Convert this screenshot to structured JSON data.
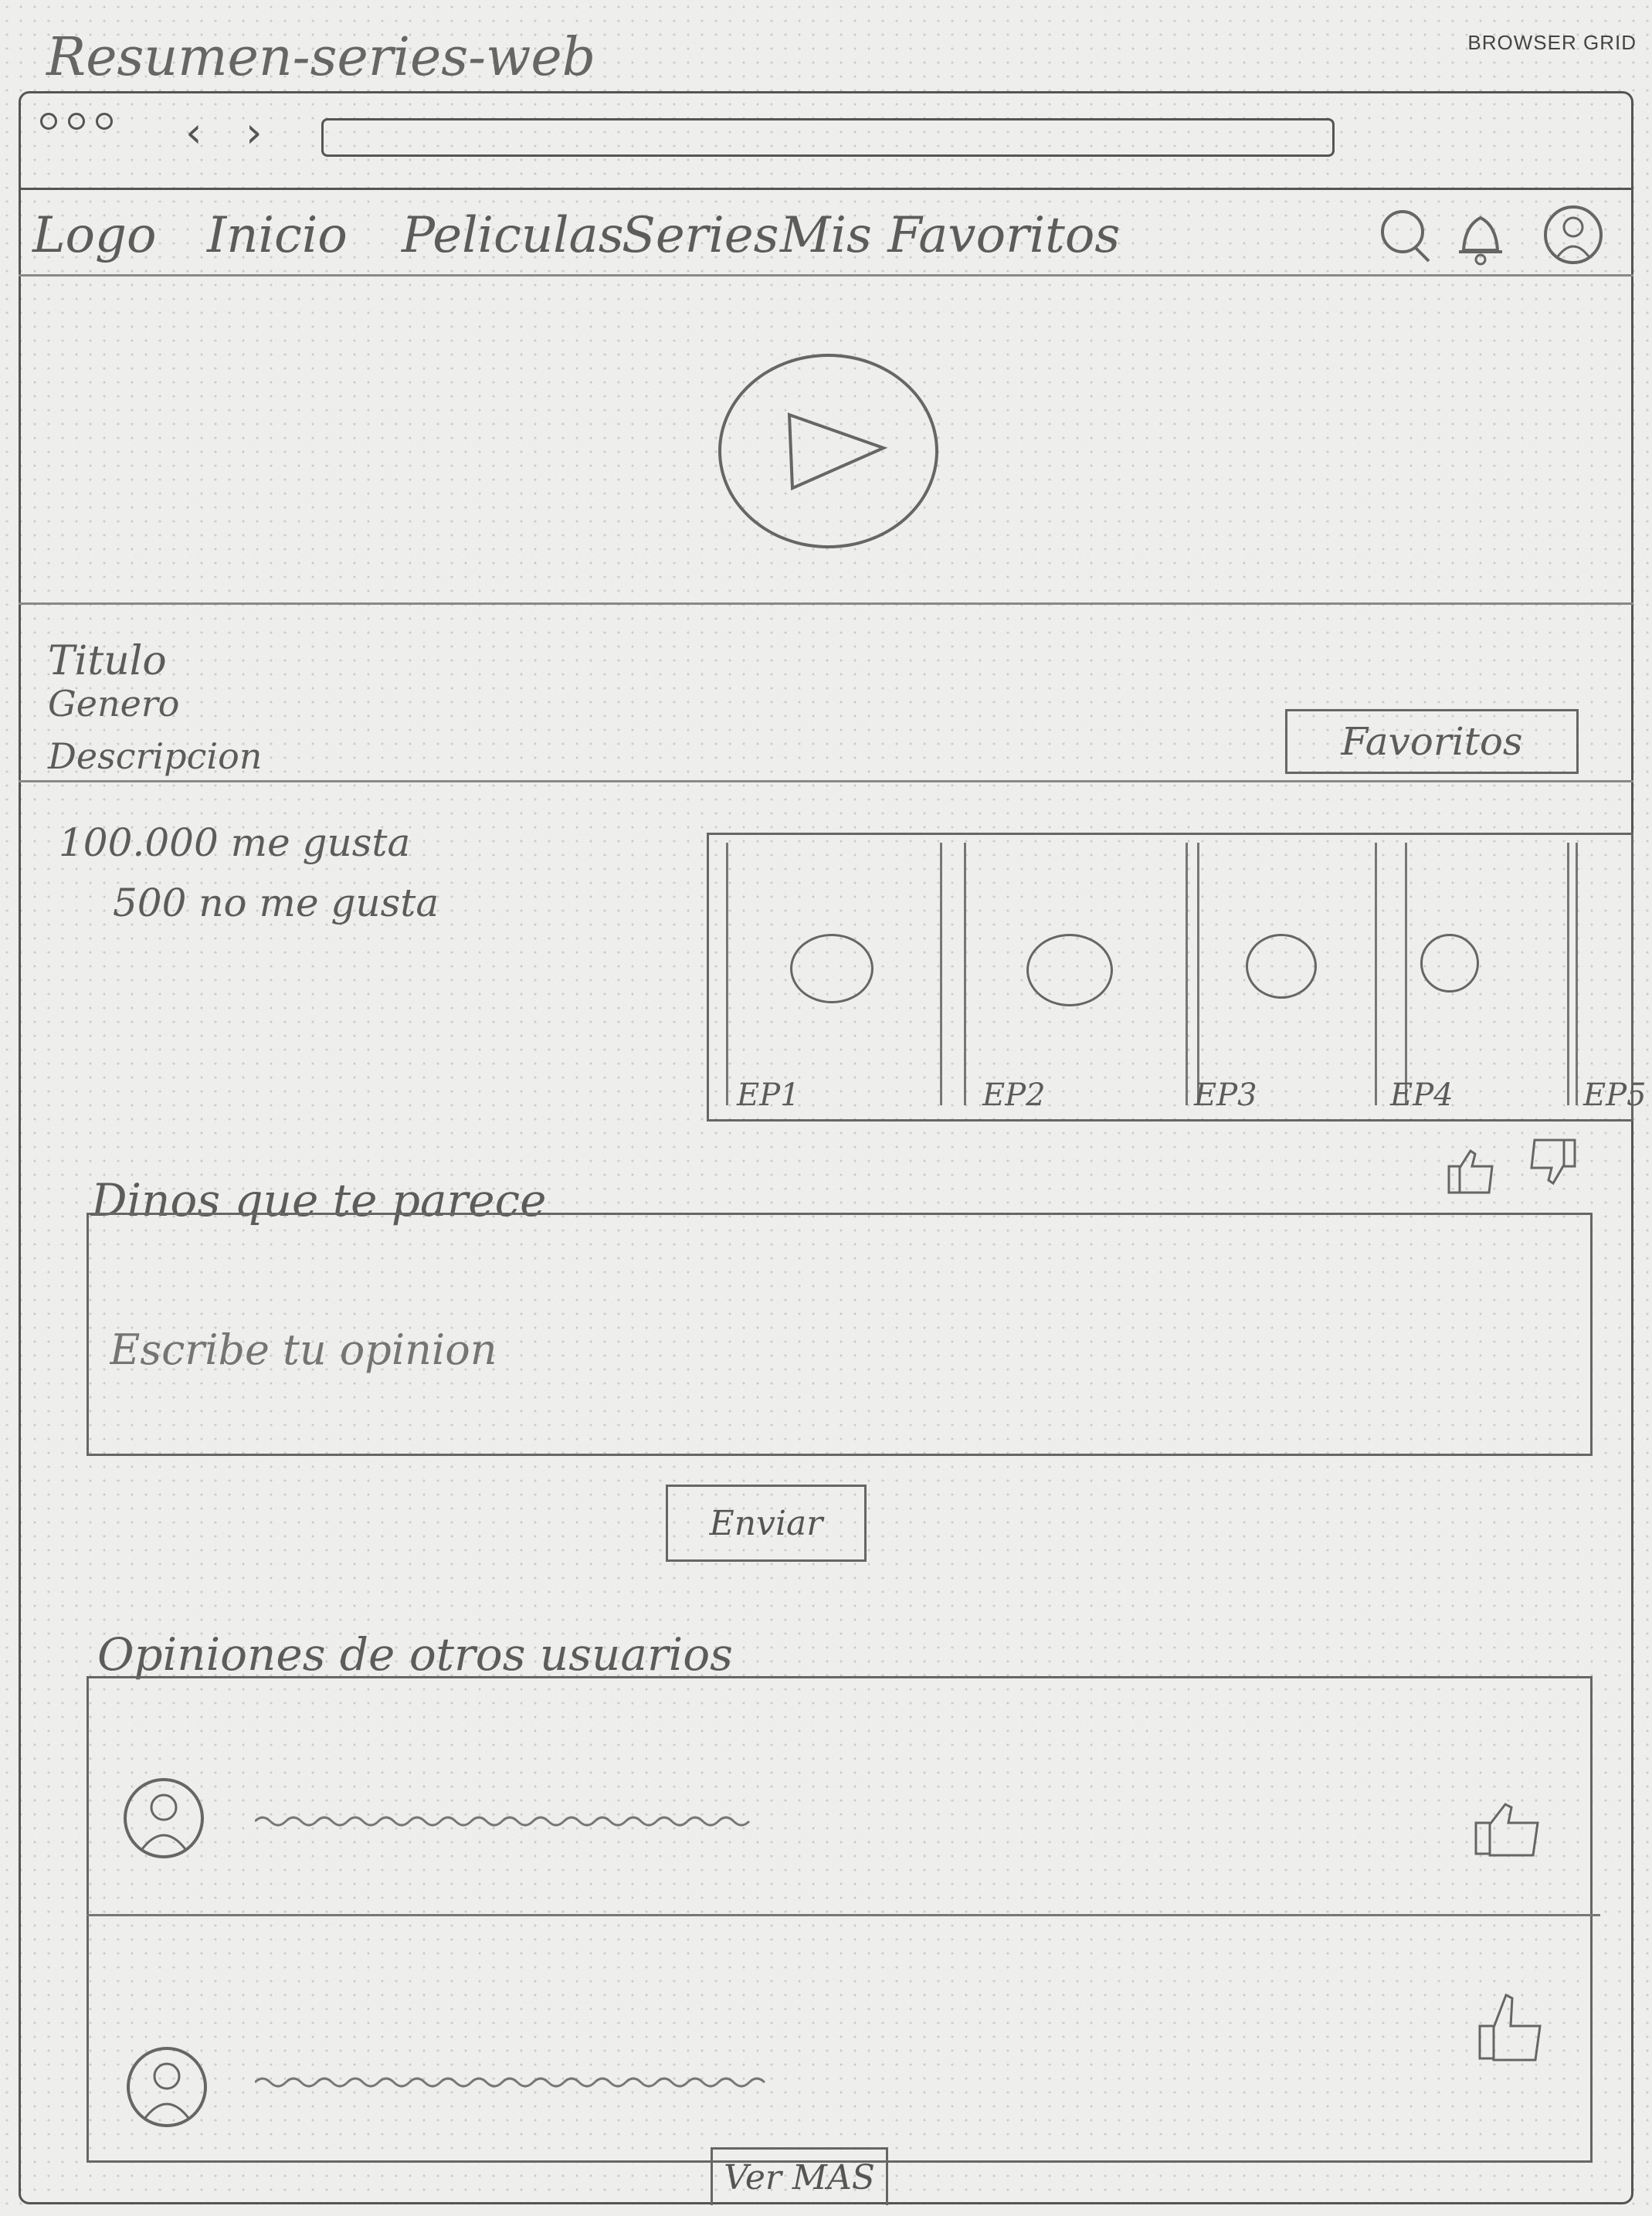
{
  "sheet": {
    "title": "Resumen-series-web",
    "grid_label": "BROWSER GRID"
  },
  "browser": {
    "back_icon": "chevron-left-icon",
    "forward_icon": "chevron-right-icon"
  },
  "navbar": {
    "logo": "Logo",
    "items": [
      "Inicio",
      "Peliculas",
      "Series",
      "Mis Favoritos"
    ],
    "icons": [
      "search-icon",
      "bell-icon",
      "user-icon"
    ]
  },
  "hero": {
    "play_icon": "play-icon"
  },
  "details": {
    "title": "Titulo",
    "genre": "Genero",
    "description": "Descripcion",
    "favorites_button": "Favoritos"
  },
  "stats": {
    "likes": "100.000 me gusta",
    "dislikes": "500 no me gusta"
  },
  "episodes": [
    "EP1",
    "EP2",
    "EP3",
    "EP4",
    "EP5"
  ],
  "feedback": {
    "title": "Dinos que te parece",
    "placeholder": "Escribe tu opinion",
    "send_button": "Enviar"
  },
  "others": {
    "title": "Opiniones de otros usuarios",
    "more_button": "Ver MAS"
  }
}
